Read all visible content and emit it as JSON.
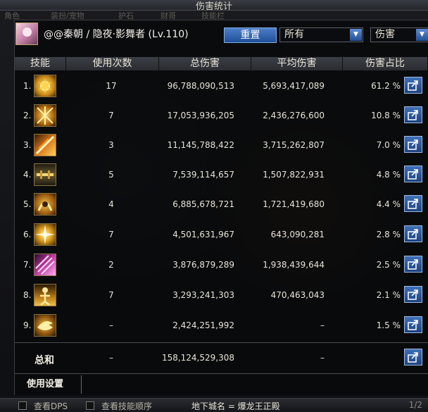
{
  "window": {
    "title": "伤害统计"
  },
  "background_tabs": [
    "角色",
    "装扮/宠物",
    "护石",
    "财哥",
    "技能栏"
  ],
  "character": {
    "name": "@@秦朝 / 隐夜·影舞者 (Lv.110)"
  },
  "toolbar": {
    "reset_label": "重置",
    "filter_value": "所有",
    "metric_value": "伤害"
  },
  "table": {
    "headers": [
      "技能",
      "使用次数",
      "总伤害",
      "平均伤害",
      "伤害占比"
    ],
    "rows": [
      {
        "rank": "1.",
        "uses": "17",
        "total": "96,788,090,513",
        "avg": "5,693,417,089",
        "pct": "61.2 %"
      },
      {
        "rank": "2.",
        "uses": "7",
        "total": "17,053,936,205",
        "avg": "2,436,276,600",
        "pct": "10.8 %"
      },
      {
        "rank": "3.",
        "uses": "3",
        "total": "11,145,788,422",
        "avg": "3,715,262,807",
        "pct": "7.0 %"
      },
      {
        "rank": "4.",
        "uses": "5",
        "total": "7,539,114,657",
        "avg": "1,507,822,931",
        "pct": "4.8 %"
      },
      {
        "rank": "5.",
        "uses": "4",
        "total": "6,885,678,721",
        "avg": "1,721,419,680",
        "pct": "4.4 %"
      },
      {
        "rank": "6.",
        "uses": "7",
        "total": "4,501,631,967",
        "avg": "643,090,281",
        "pct": "2.8 %"
      },
      {
        "rank": "7.",
        "uses": "2",
        "total": "3,876,879,289",
        "avg": "1,938,439,644",
        "pct": "2.5 %"
      },
      {
        "rank": "8.",
        "uses": "7",
        "total": "3,293,241,303",
        "avg": "470,463,043",
        "pct": "2.1 %"
      },
      {
        "rank": "9.",
        "uses": "–",
        "total": "2,424,251,992",
        "avg": "–",
        "pct": "1.5 %"
      }
    ],
    "summary": {
      "label": "总和",
      "uses": "–",
      "total": "158,124,529,308",
      "avg": "–"
    }
  },
  "footer": {
    "settings_label": "使用设置"
  },
  "bottom_bar": {
    "check_dps": "查看DPS",
    "check_order": "查看技能顺序",
    "dungeon": "地下城名 = 爆龙王正殿",
    "page": "1/2"
  },
  "colors": {
    "accent": "#2a5aa8",
    "panel": "#0c0d10",
    "text": "#e8e4d8"
  }
}
